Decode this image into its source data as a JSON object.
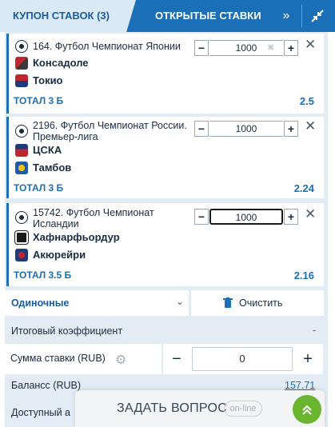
{
  "tabs": {
    "coupon": "КУПОН СТАВОК (3)",
    "open_bets": "ОТКРЫТЫЕ СТАВКИ",
    "next_icon": "double-chevron-right-icon",
    "collapse_icon": "collapse-arrows-icon"
  },
  "bets": [
    {
      "league": "164. Футбол Чемпионат Японии",
      "team1": "Консадоле",
      "team2": "Токио",
      "market": "ТОТАЛ 3 Б",
      "coef": "2.5",
      "stake": "1000"
    },
    {
      "league": "2196. Футбол Чемпионат России. Премьер-лига",
      "team1": "ЦСКА",
      "team2": "Тамбов",
      "market": "ТОТАЛ 3 Б",
      "coef": "2.24",
      "stake": "1000"
    },
    {
      "league": "15742. Футбол Чемпионат Исландии",
      "team1": "Хафнарфьордур",
      "team2": "Акюрейри",
      "market": "ТОТАЛ 3.5 Б",
      "coef": "2.16",
      "stake": "1000"
    }
  ],
  "bet_type": {
    "selected": "Одиночные"
  },
  "clear_label": "Очистить",
  "total_coef": {
    "label": "Итоговый коэффициент",
    "value": "-"
  },
  "stake_sum": {
    "label": "Сумма ставки (RUB)",
    "value": "0"
  },
  "balance": {
    "label": "Балансс (RUB)",
    "value": "157.71"
  },
  "available": {
    "label": "Доступный а"
  },
  "chat": {
    "label": "ЗАДАТЬ ВОПРОС",
    "status": "on-line"
  },
  "colors": {
    "header_blue": "#1a6fb7",
    "tab_active_bg": "#d9e9f6",
    "coupon_bg": "#e3ecf4",
    "chat_green": "#6ab52f"
  }
}
